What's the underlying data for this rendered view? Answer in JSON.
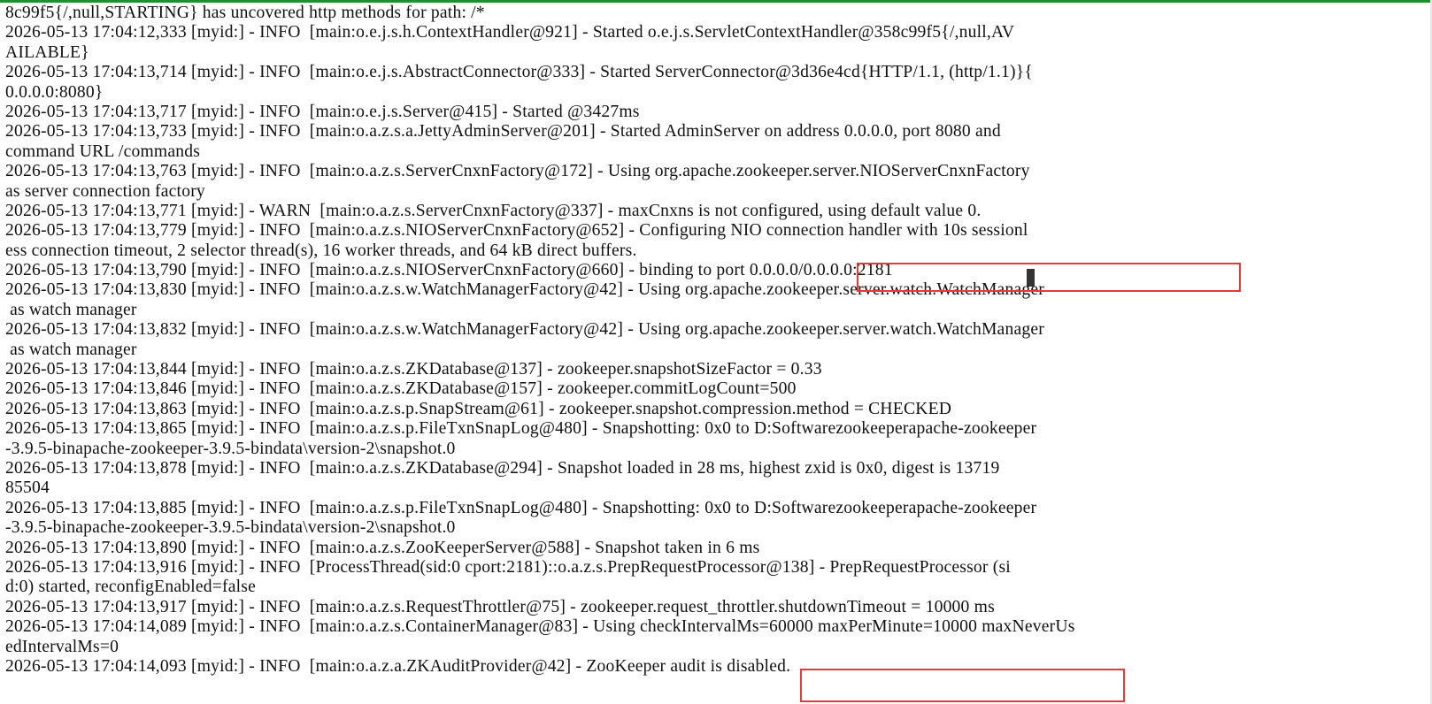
{
  "terminal": {
    "lines": [
      "8c99f5{/,null,STARTING} has uncovered http methods for path: /*",
      "2026-05-13 17:04:12,333 [myid:] - INFO  [main:o.e.j.s.h.ContextHandler@921] - Started o.e.j.s.ServletContextHandler@358c99f5{/,null,AV",
      "AILABLE}",
      "2026-05-13 17:04:13,714 [myid:] - INFO  [main:o.e.j.s.AbstractConnector@333] - Started ServerConnector@3d36e4cd{HTTP/1.1, (http/1.1)}{",
      "0.0.0.0:8080}",
      "2026-05-13 17:04:13,717 [myid:] - INFO  [main:o.e.j.s.Server@415] - Started @3427ms",
      "2026-05-13 17:04:13,733 [myid:] - INFO  [main:o.a.z.s.a.JettyAdminServer@201] - Started AdminServer on address 0.0.0.0, port 8080 and",
      "command URL /commands",
      "2026-05-13 17:04:13,763 [myid:] - INFO  [main:o.a.z.s.ServerCnxnFactory@172] - Using org.apache.zookeeper.server.NIOServerCnxnFactory",
      "as server connection factory",
      "2026-05-13 17:04:13,771 [myid:] - WARN  [main:o.a.z.s.ServerCnxnFactory@337] - maxCnxns is not configured, using default value 0.",
      "2026-05-13 17:04:13,779 [myid:] - INFO  [main:o.a.z.s.NIOServerCnxnFactory@652] - Configuring NIO connection handler with 10s sessionl",
      "ess connection timeout, 2 selector thread(s), 16 worker threads, and 64 kB direct buffers.",
      "2026-05-13 17:04:13,790 [myid:] - INFO  [main:o.a.z.s.NIOServerCnxnFactory@660] - binding to port 0.0.0.0/0.0.0.0:2181",
      "2026-05-13 17:04:13,830 [myid:] - INFO  [main:o.a.z.s.w.WatchManagerFactory@42] - Using org.apache.zookeeper.server.watch.WatchManager",
      " as watch manager",
      "2026-05-13 17:04:13,832 [myid:] - INFO  [main:o.a.z.s.w.WatchManagerFactory@42] - Using org.apache.zookeeper.server.watch.WatchManager",
      " as watch manager",
      "2026-05-13 17:04:13,844 [myid:] - INFO  [main:o.a.z.s.ZKDatabase@137] - zookeeper.snapshotSizeFactor = 0.33",
      "2026-05-13 17:04:13,846 [myid:] - INFO  [main:o.a.z.s.ZKDatabase@157] - zookeeper.commitLogCount=500",
      "2026-05-13 17:04:13,863 [myid:] - INFO  [main:o.a.z.s.p.SnapStream@61] - zookeeper.snapshot.compression.method = CHECKED",
      "2026-05-13 17:04:13,865 [myid:] - INFO  [main:o.a.z.s.p.FileTxnSnapLog@480] - Snapshotting: 0x0 to D:Softwarezookeeperapache-zookeeper",
      "-3.9.5-binapache-zookeeper-3.9.5-bindata\\version-2\\snapshot.0",
      "2026-05-13 17:04:13,878 [myid:] - INFO  [main:o.a.z.s.ZKDatabase@294] - Snapshot loaded in 28 ms, highest zxid is 0x0, digest is 13719",
      "85504",
      "2026-05-13 17:04:13,885 [myid:] - INFO  [main:o.a.z.s.p.FileTxnSnapLog@480] - Snapshotting: 0x0 to D:Softwarezookeeperapache-zookeeper",
      "-3.9.5-binapache-zookeeper-3.9.5-bindata\\version-2\\snapshot.0",
      "2026-05-13 17:04:13,890 [myid:] - INFO  [main:o.a.z.s.ZooKeeperServer@588] - Snapshot taken in 6 ms",
      "2026-05-13 17:04:13,916 [myid:] - INFO  [ProcessThread(sid:0 cport:2181)::o.a.z.s.PrepRequestProcessor@138] - PrepRequestProcessor (si",
      "d:0) started, reconfigEnabled=false",
      "2026-05-13 17:04:13,917 [myid:] - INFO  [main:o.a.z.s.RequestThrottler@75] - zookeeper.request_throttler.shutdownTimeout = 10000 ms",
      "2026-05-13 17:04:14,089 [myid:] - INFO  [main:o.a.z.s.ContainerManager@83] - Using checkIntervalMs=60000 maxPerMinute=10000 maxNeverUs",
      "edIntervalMs=0",
      "2026-05-13 17:04:14,093 [myid:] - INFO  [main:o.a.z.a.ZKAuditProvider@42] - ZooKeeper audit is disabled."
    ]
  },
  "colors": {
    "background": "#ffffff",
    "text": "#111111",
    "highlight_border": "#e33b3b",
    "top_border": "#1f8f2f"
  }
}
